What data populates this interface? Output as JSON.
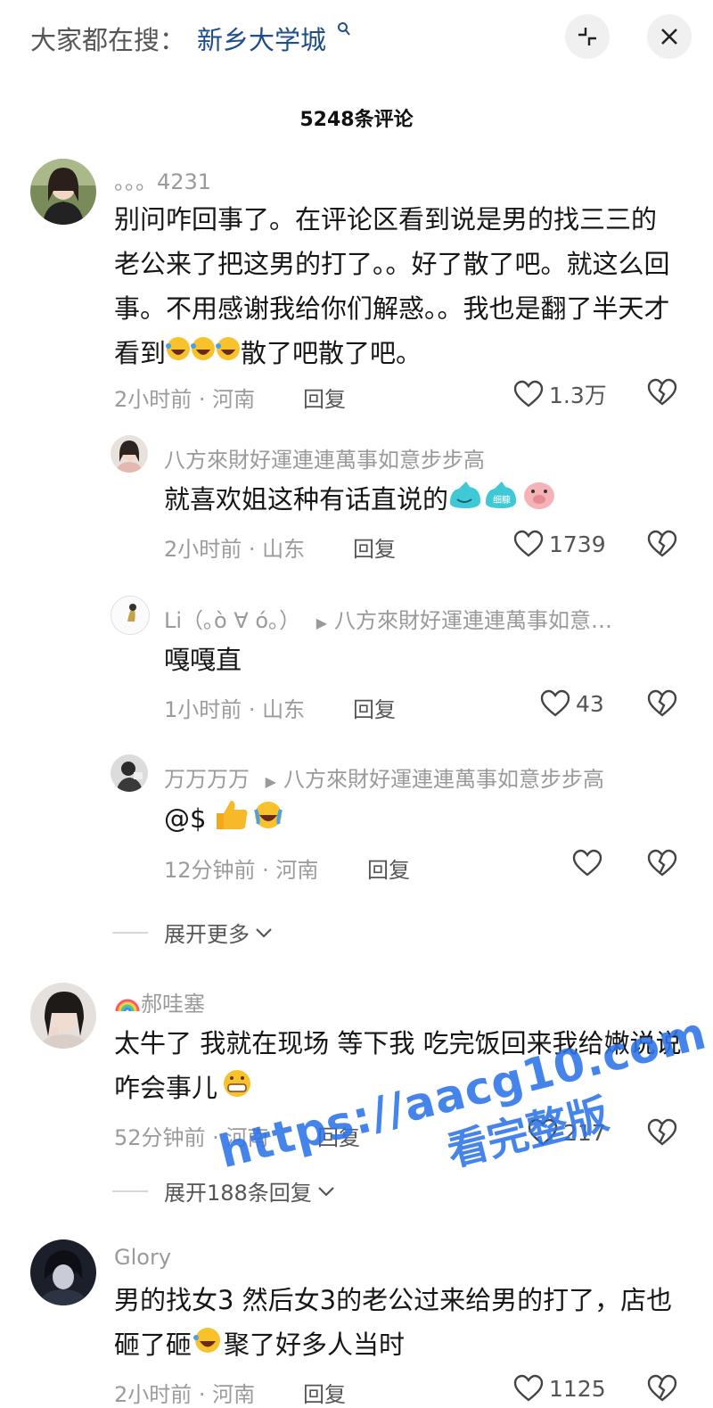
{
  "header": {
    "hot_label": "大家都在搜：",
    "hot_term": "新乡大学城"
  },
  "comment_count_title": "5248条评论",
  "comments": [
    {
      "username": "。。。4231",
      "content": "别问咋回事了。在评论区看到说是男的找三三的老公来了把这男的打了。。好了散了吧。就这么回事。不用感谢我给你们解惑。。我也是翻了半天才看到",
      "content_tail": "散了吧散了吧。",
      "time_location": "2小时前 · 河南",
      "reply_label": "回复",
      "likes": "1.3万",
      "replies": [
        {
          "username": "八方來財好運連連萬事如意步步高",
          "content": "就喜欢姐这种有话直说的",
          "time_location": "2小时前 · 山东",
          "reply_label": "回复",
          "likes": "1739"
        },
        {
          "username": "Li（｡ò ∀ ó｡）",
          "reply_to": "八方來財好運連連萬事如意…",
          "content": "嘎嘎直",
          "time_location": "1小时前 · 山东",
          "reply_label": "回复",
          "likes": "43"
        },
        {
          "username": "万万万万",
          "reply_to": "八方來財好運連連萬事如意步步高",
          "content": "@$",
          "time_location": "12分钟前 · 河南",
          "reply_label": "回复",
          "likes": ""
        }
      ],
      "expand_label": "展开更多"
    },
    {
      "username": "郝哇塞",
      "content": "太牛了 我就在现场 等下我 吃完饭回来我给嫩说说咋会事儿",
      "time_location": "52分钟前 · 河南",
      "reply_label": "回复",
      "likes": "217",
      "expand_label": "展开188条回复"
    },
    {
      "username": "Glory",
      "content_a": "男的找女3 然后女3的老公过来给男的打了，店也砸了砸",
      "content_b": "聚了好多人当时",
      "time_location": "2小时前 · 河南",
      "reply_label": "回复",
      "likes": "1125"
    }
  ],
  "watermark": {
    "url": "https://aacg10.com",
    "sub": "看完整版"
  },
  "colors": {
    "link_blue": "#1f4e8c",
    "watermark_blue": "#2c74e8"
  }
}
